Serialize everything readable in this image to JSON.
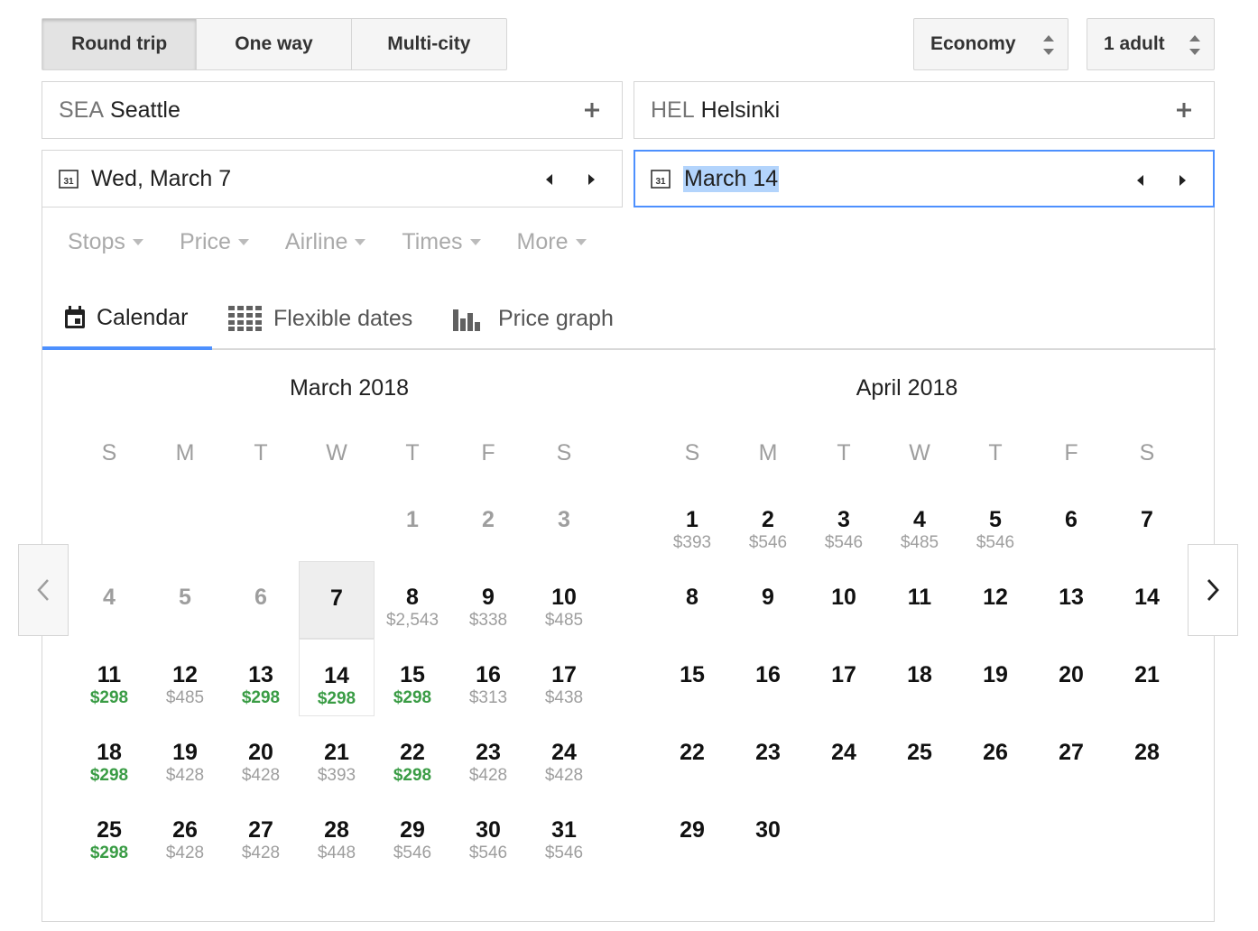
{
  "trip_type": {
    "options": [
      "Round trip",
      "One way",
      "Multi-city"
    ],
    "selected": "Round trip"
  },
  "cabin": {
    "value": "Economy"
  },
  "passengers": {
    "value": "1 adult"
  },
  "origin": {
    "code": "SEA",
    "city": "Seattle"
  },
  "destination": {
    "code": "HEL",
    "city": "Helsinki"
  },
  "depart_date": {
    "value": "Wed, March 7"
  },
  "return_date": {
    "value": "March 14"
  },
  "filters": [
    "Stops",
    "Price",
    "Airline",
    "Times",
    "More"
  ],
  "view_tabs": [
    "Calendar",
    "Flexible dates",
    "Price graph"
  ],
  "weekday_labels": [
    "S",
    "M",
    "T",
    "W",
    "T",
    "F",
    "S"
  ],
  "colors": {
    "accent": "#4d90fe",
    "low_price": "#3a9c45",
    "muted": "#9e9e9e"
  },
  "months": [
    {
      "title": "March 2018",
      "days": [
        {
          "d": "1",
          "p": "",
          "past": true
        },
        {
          "d": "2",
          "p": "",
          "past": true
        },
        {
          "d": "3",
          "p": "",
          "past": true
        },
        {
          "d": "4",
          "p": "",
          "past": true
        },
        {
          "d": "5",
          "p": "",
          "past": true
        },
        {
          "d": "6",
          "p": "",
          "past": true
        },
        {
          "d": "7",
          "p": "",
          "past": false
        },
        {
          "d": "8",
          "p": "$2,543"
        },
        {
          "d": "9",
          "p": "$338"
        },
        {
          "d": "10",
          "p": "$485"
        },
        {
          "d": "11",
          "p": "$298",
          "low": true
        },
        {
          "d": "12",
          "p": "$485"
        },
        {
          "d": "13",
          "p": "$298",
          "low": true
        },
        {
          "d": "14",
          "p": "$298",
          "low": true
        },
        {
          "d": "15",
          "p": "$298",
          "low": true
        },
        {
          "d": "16",
          "p": "$313"
        },
        {
          "d": "17",
          "p": "$438"
        },
        {
          "d": "18",
          "p": "$298",
          "low": true
        },
        {
          "d": "19",
          "p": "$428"
        },
        {
          "d": "20",
          "p": "$428"
        },
        {
          "d": "21",
          "p": "$393"
        },
        {
          "d": "22",
          "p": "$298",
          "low": true
        },
        {
          "d": "23",
          "p": "$428"
        },
        {
          "d": "24",
          "p": "$428"
        },
        {
          "d": "25",
          "p": "$298",
          "low": true
        },
        {
          "d": "26",
          "p": "$428"
        },
        {
          "d": "27",
          "p": "$428"
        },
        {
          "d": "28",
          "p": "$448"
        },
        {
          "d": "29",
          "p": "$546"
        },
        {
          "d": "30",
          "p": "$546"
        },
        {
          "d": "31",
          "p": "$546"
        }
      ]
    },
    {
      "title": "April 2018",
      "days": [
        {
          "d": "1",
          "p": "$393"
        },
        {
          "d": "2",
          "p": "$546"
        },
        {
          "d": "3",
          "p": "$546"
        },
        {
          "d": "4",
          "p": "$485"
        },
        {
          "d": "5",
          "p": "$546"
        },
        {
          "d": "6",
          "p": ""
        },
        {
          "d": "7",
          "p": ""
        },
        {
          "d": "8",
          "p": ""
        },
        {
          "d": "9",
          "p": ""
        },
        {
          "d": "10",
          "p": ""
        },
        {
          "d": "11",
          "p": ""
        },
        {
          "d": "12",
          "p": ""
        },
        {
          "d": "13",
          "p": ""
        },
        {
          "d": "14",
          "p": ""
        },
        {
          "d": "15",
          "p": ""
        },
        {
          "d": "16",
          "p": ""
        },
        {
          "d": "17",
          "p": ""
        },
        {
          "d": "18",
          "p": ""
        },
        {
          "d": "19",
          "p": ""
        },
        {
          "d": "20",
          "p": ""
        },
        {
          "d": "21",
          "p": ""
        },
        {
          "d": "22",
          "p": ""
        },
        {
          "d": "23",
          "p": ""
        },
        {
          "d": "24",
          "p": ""
        },
        {
          "d": "25",
          "p": ""
        },
        {
          "d": "26",
          "p": ""
        },
        {
          "d": "27",
          "p": ""
        },
        {
          "d": "28",
          "p": ""
        },
        {
          "d": "29",
          "p": ""
        },
        {
          "d": "30",
          "p": ""
        }
      ]
    }
  ]
}
